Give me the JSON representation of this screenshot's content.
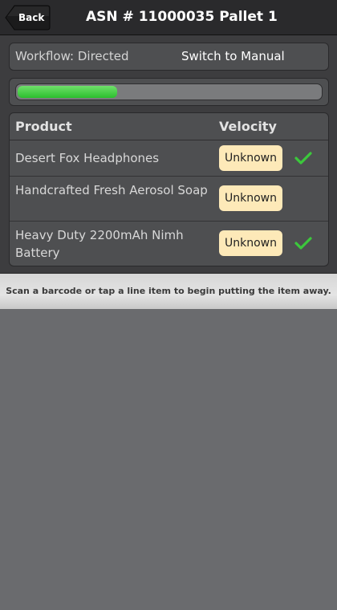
{
  "header": {
    "back_label": "Back",
    "title": "ASN # 11000035 Pallet 1"
  },
  "workflow": {
    "label": "Workflow: Directed",
    "switch_label": "Switch to Manual"
  },
  "progress": {
    "fraction": 0.33,
    "color": "#2bbf2e"
  },
  "table": {
    "columns": [
      "Product",
      "Velocity"
    ],
    "rows": [
      {
        "product": "Desert Fox Headphones",
        "velocity": "Unknown",
        "done": true
      },
      {
        "product": "Handcrafted Fresh Aerosol Soap",
        "velocity": "Unknown",
        "done": false
      },
      {
        "product": "Heavy Duty 2200mAh Nimh Battery",
        "velocity": "Unknown",
        "done": true
      }
    ]
  },
  "hint": "Scan a barcode or tap a line item to begin putting the item away.",
  "colors": {
    "check": "#3cc83c",
    "badge": "#fde9b8"
  },
  "icons": {
    "back": "back-arrow-button-icon",
    "check": "checkmark-icon"
  }
}
